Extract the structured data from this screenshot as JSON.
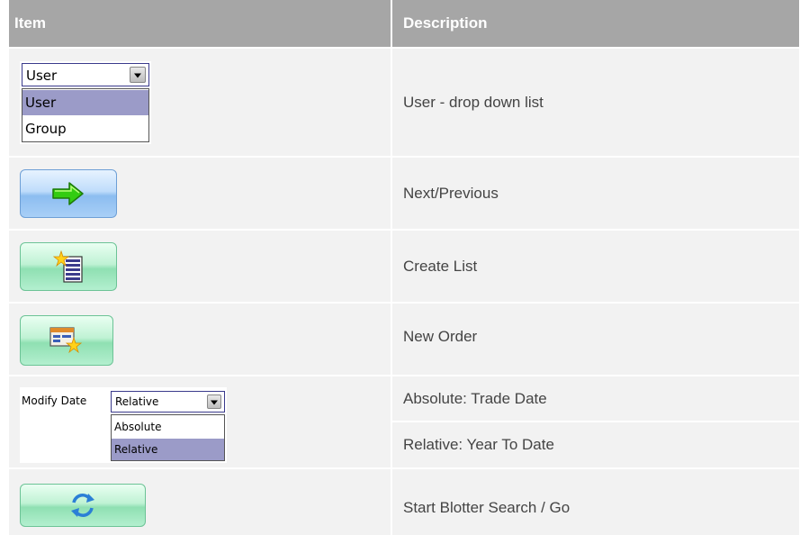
{
  "header": {
    "item": "Item",
    "description": "Description"
  },
  "rows": [
    {
      "user_combo": {
        "value": "User",
        "options": [
          "User",
          "Group"
        ],
        "highlighted": "User"
      },
      "description": "User - drop down list"
    },
    {
      "icon": "green-arrow-right-icon",
      "description": "Next/Previous"
    },
    {
      "icon": "create-list-icon",
      "description": "Create List"
    },
    {
      "icon": "new-order-icon",
      "description": "New Order"
    },
    {
      "label": "Modify Date",
      "date_combo": {
        "value": "Relative",
        "options": [
          "Absolute",
          "Relative"
        ],
        "highlighted": "Relative"
      },
      "descriptions": [
        "Absolute: Trade Date",
        "Relative: Year To Date"
      ]
    },
    {
      "icon": "refresh-icon",
      "description": "Start Blotter Search / Go"
    }
  ]
}
